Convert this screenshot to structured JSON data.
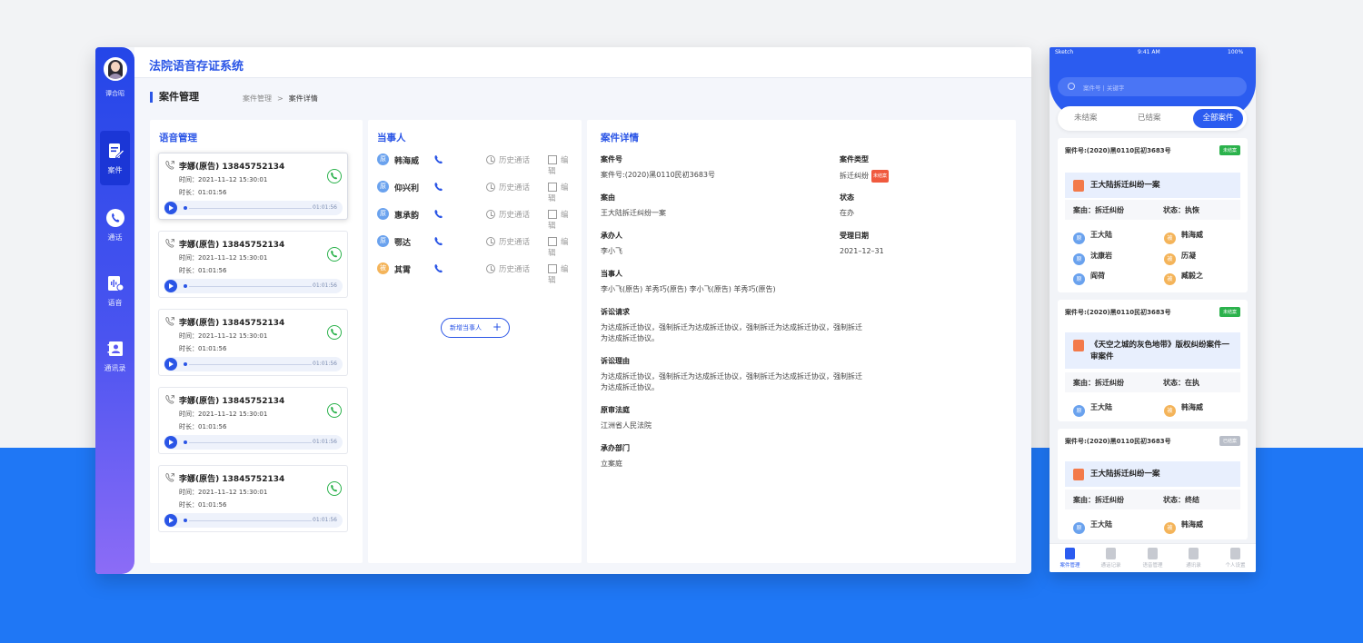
{
  "desktop": {
    "app_title": "法院语音存证系统",
    "user_name": "谭合昭",
    "nav": [
      {
        "label": "案件"
      },
      {
        "label": "通话"
      },
      {
        "label": "语音"
      },
      {
        "label": "通讯录"
      }
    ],
    "section_title": "案件管理",
    "breadcrumb": [
      "案件管理",
      "案件详情"
    ],
    "voice_panel": {
      "title": "语音管理",
      "records": [
        {
          "name": "李娜(原告) 13845752134",
          "time": "时间：2021–11–12 15:30:01",
          "duration": "时长：01:01:56",
          "player_duration": "01:01:56"
        },
        {
          "name": "李娜(原告) 13845752134",
          "time": "时间：2021–11–12 15:30:01",
          "duration": "时长：01:01:56",
          "player_duration": "01:01:56"
        },
        {
          "name": "李娜(原告) 13845752134",
          "time": "时间：2021–11–12 15:30:01",
          "duration": "时长：01:01:56",
          "player_duration": "01:01:56"
        },
        {
          "name": "李娜(原告) 13845752134",
          "time": "时间：2021–11–12 15:30:01",
          "duration": "时长：01:01:56",
          "player_duration": "01:01:56"
        },
        {
          "name": "李娜(原告) 13845752134",
          "time": "时间：2021–11–12 15:30:01",
          "duration": "时长：01:01:56",
          "player_duration": "01:01:56"
        }
      ]
    },
    "party_panel": {
      "title": "当事人",
      "history_label": "历史通话",
      "edit_label": "编辑",
      "add_label": "新增当事人",
      "parties": [
        {
          "badge": "原",
          "name": "韩海威",
          "role": "orig"
        },
        {
          "badge": "原",
          "name": "仰兴利",
          "role": "orig"
        },
        {
          "badge": "原",
          "name": "惠承韵",
          "role": "orig"
        },
        {
          "badge": "原",
          "name": "鄂达",
          "role": "orig"
        },
        {
          "badge": "被",
          "name": "其霄",
          "role": "def"
        }
      ]
    },
    "detail_panel": {
      "title": "案件详情",
      "case_no_label": "案件号",
      "case_no": "案件号:(2020)黑0110民初3683号",
      "case_type_label": "案件类型",
      "case_type": "拆迁纠纷",
      "case_type_tag": "未结案",
      "cause_label": "案由",
      "cause": "王大陆拆迁纠纷一案",
      "status_label": "状态",
      "status": "在办",
      "handler_label": "承办人",
      "handler": "李小飞",
      "accept_label": "受理日期",
      "accept_date": "2021–12–31",
      "parties_label": "当事人",
      "parties": "李小飞(原告)  羊秀巧(原告)  李小飞(原告)  羊秀巧(原告)",
      "claim_label": "诉讼请求",
      "claim": "为达成拆迁协议，强制拆迁为达成拆迁协议，强制拆迁为达成拆迁协议，强制拆迁为达成拆迁协议。",
      "reason_label": "诉讼理由",
      "reason": "为达成拆迁协议，强制拆迁为达成拆迁协议，强制拆迁为达成拆迁协议，强制拆迁为达成拆迁协议。",
      "court_label": "原审法庭",
      "court": "江洲省人民法院",
      "dept_label": "承办部门",
      "dept": "立案庭"
    }
  },
  "mobile": {
    "status_left": "Sketch",
    "status_time": "9:41 AM",
    "status_right": "100%",
    "search_placeholder": "案件号 | 关键字",
    "tabs": [
      "未结案",
      "已结案",
      "全部案件"
    ],
    "cards": [
      {
        "case_no": "案件号:(2020)黑0110民初3683号",
        "status": "未结案",
        "name": "王大陆拆迁纠纷一案",
        "cause": "案由：拆迁纠纷",
        "state": "状态：执恢",
        "people": [
          {
            "badge": "原",
            "name": "王大陆",
            "role": "orig"
          },
          {
            "badge": "被",
            "name": "韩海威",
            "role": "def"
          },
          {
            "badge": "原",
            "name": "沈康岩",
            "role": "orig"
          },
          {
            "badge": "被",
            "name": "历凝",
            "role": "def"
          },
          {
            "badge": "原",
            "name": "阎荷",
            "role": "orig"
          },
          {
            "badge": "被",
            "name": "臧毅之",
            "role": "def"
          }
        ]
      },
      {
        "case_no": "案件号:(2020)黑0110民初3683号",
        "status": "未结案",
        "name": "《天空之城的灰色地带》版权纠纷案件一审案件",
        "cause": "案由：拆迁纠纷",
        "state": "状态：在执",
        "people": [
          {
            "badge": "原",
            "name": "王大陆",
            "role": "orig"
          },
          {
            "badge": "被",
            "name": "韩海威",
            "role": "def"
          }
        ]
      },
      {
        "case_no": "案件号:(2020)黑0110民初3683号",
        "status": "已结案",
        "name": "王大陆拆迁纠纷一案",
        "cause": "案由：拆迁纠纷",
        "state": "状态：终结",
        "people": [
          {
            "badge": "原",
            "name": "王大陆",
            "role": "orig"
          },
          {
            "badge": "被",
            "name": "韩海威",
            "role": "def"
          }
        ]
      }
    ],
    "bottom_nav": [
      "案件管理",
      "通话记录",
      "语音管理",
      "通讯录",
      "个人设置"
    ]
  },
  "colors": {
    "primary": "#2a55e6",
    "bg_blue": "#1f77f5",
    "green": "#2bb24c",
    "orange": "#f4b45a"
  }
}
